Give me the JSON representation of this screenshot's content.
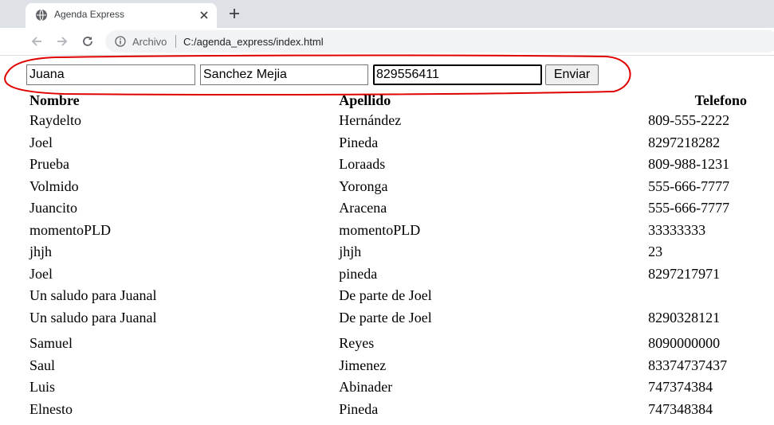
{
  "browser": {
    "tab_title": "Agenda Express",
    "security_label": "Archivo",
    "url": "C:/agenda_express/index.html"
  },
  "form": {
    "nombre_value": "Juana",
    "apellido_value": "Sanchez Mejia",
    "telefono_value": "829556411",
    "submit_label": "Enviar"
  },
  "table": {
    "headers": [
      "Nombre",
      "Apellido",
      "Telefono"
    ],
    "rows": [
      [
        "Raydelto",
        "Hernández",
        "809-555-2222"
      ],
      [
        "Joel",
        "Pineda",
        "8297218282"
      ],
      [
        "Prueba",
        "Loraads",
        "809-988-1231"
      ],
      [
        "Volmido",
        "Yoronga",
        "555-666-7777"
      ],
      [
        "Juancito",
        "Aracena",
        "555-666-7777"
      ],
      [
        "momentoPLD",
        "momentoPLD",
        "33333333"
      ],
      [
        "jhjh",
        "jhjh",
        "23"
      ],
      [
        "Joel",
        "pineda",
        "8297217971"
      ],
      [
        "Un saludo para Juanal",
        "De parte de Joel",
        ""
      ],
      [
        "Un saludo para Juanal",
        "De parte de Joel",
        "8290328121"
      ],
      [
        "Samuel",
        "Reyes",
        "8090000000"
      ],
      [
        "Saul",
        "Jimenez",
        "83374737437"
      ],
      [
        "Luis",
        "Abinader",
        "747374384"
      ],
      [
        "Elnesto",
        "Pineda",
        "747348384"
      ]
    ]
  },
  "colors": {
    "annotation": "#e00000",
    "tabstrip": "#dee1e6",
    "omnibox": "#f1f3f4"
  }
}
